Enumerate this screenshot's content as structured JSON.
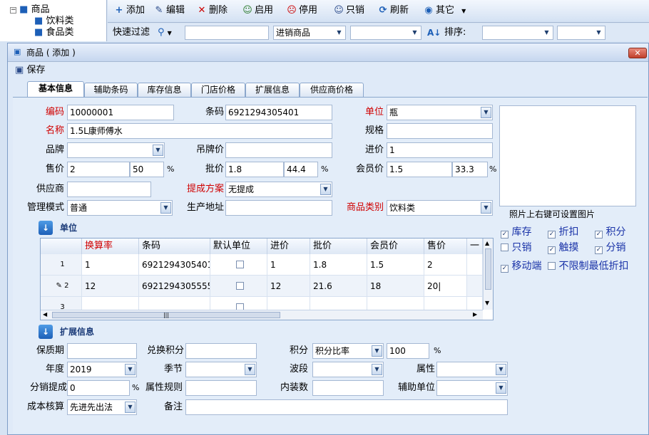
{
  "tree": {
    "root": "商品",
    "children": [
      "饮料类",
      "食品类"
    ]
  },
  "toolbar": {
    "add": "添加",
    "edit": "编辑",
    "delete": "删除",
    "enable": "启用",
    "disable": "停用",
    "sell_only": "只销",
    "refresh": "刷新",
    "other": "其它"
  },
  "filter": {
    "label": "快速过滤",
    "mode": "进销商品",
    "sort_label": "排序:"
  },
  "dialog": {
    "title": "商品 ( 添加 )",
    "save": "保存"
  },
  "tabs": [
    "基本信息",
    "辅助条码",
    "库存信息",
    "门店价格",
    "扩展信息",
    "供应商价格"
  ],
  "form": {
    "code_label": "编码",
    "code": "10000001",
    "barcode_label": "条码",
    "barcode": "6921294305401",
    "unit_label": "单位",
    "unit": "瓶",
    "name_label": "名称",
    "name": "1.5L康师傅水",
    "spec_label": "规格",
    "brand_label": "品牌",
    "tag_price_label": "吊牌价",
    "purchase_label": "进价",
    "purchase": "1",
    "sale_label": "售价",
    "sale": "2",
    "sale_pct": "50",
    "wholesale_label": "批价",
    "wholesale": "1.8",
    "wholesale_pct": "44.4",
    "member_label": "会员价",
    "member": "1.5",
    "member_pct": "33.3",
    "pct_sign": "%",
    "supplier_label": "供应商",
    "commission_label": "提成方案",
    "commission": "无提成",
    "mgmt_label": "管理模式",
    "mgmt": "普通",
    "origin_label": "生产地址",
    "category_label": "商品类别",
    "category": "饮料类",
    "photo_hint": "照片上右键可设置图片"
  },
  "options": [
    {
      "label": "库存",
      "checked": "✓"
    },
    {
      "label": "折扣",
      "checked": "✓"
    },
    {
      "label": "积分",
      "checked": "✓"
    },
    {
      "label": "只销",
      "checked": ""
    },
    {
      "label": "触摸",
      "checked": "✓"
    },
    {
      "label": "分销",
      "checked": "✓"
    },
    {
      "label": "移动端",
      "checked": "✓"
    },
    {
      "label": "不限制最低折扣",
      "checked": ""
    }
  ],
  "unit_section": {
    "title": "单位"
  },
  "grid": {
    "columns": [
      "换算率",
      "条码",
      "默认单位",
      "进价",
      "批价",
      "会员价",
      "售价",
      "一"
    ],
    "rows": [
      {
        "num": "1",
        "cells": [
          "1",
          "6921294305401",
          "",
          "1",
          "1.8",
          "1.5",
          "2"
        ]
      },
      {
        "num": "2",
        "cells": [
          "12",
          "6921294305555",
          "",
          "12",
          "21.6",
          "18",
          "20"
        ]
      },
      {
        "num": "3",
        "cells": [
          "",
          "",
          "",
          "",
          "",
          "",
          ""
        ]
      }
    ]
  },
  "ext_section": {
    "title": "扩展信息",
    "shelf_label": "保质期",
    "exchange_label": "兑换积分",
    "points_label": "积分",
    "points_mode": "积分比率",
    "points_value": "100",
    "year_label": "年度",
    "year": "2019",
    "season_label": "季节",
    "wave_label": "波段",
    "attr_label": "属性",
    "dist_label": "分销提成",
    "dist_value": "0",
    "attr_rule_label": "属性规则",
    "inner_label": "内装数",
    "aux_unit_label": "辅助单位",
    "cost_label": "成本核算",
    "cost": "先进先出法",
    "remark_label": "备注"
  },
  "colors": {
    "label_red": "#d00000",
    "option_blue": "#1a33a8",
    "accent": "#1d5fb7"
  }
}
